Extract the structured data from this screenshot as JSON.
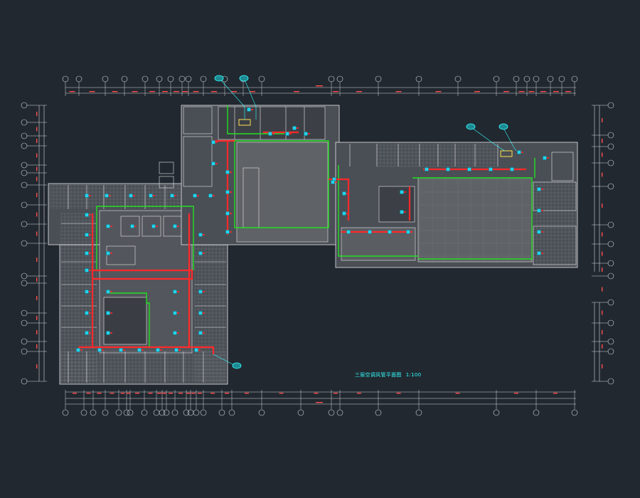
{
  "drawing": {
    "title": "三层空调风管平面图",
    "scale": "1:100"
  },
  "colors": {
    "background": "#212830",
    "dimension_line": "#d9d9d9",
    "dimension_text": "#ff4d4d",
    "wall": "#e6e6e6",
    "fill_dark": "#4a4e55",
    "fill_floor": "#5f6266",
    "supply_duct": "#ff2a2a",
    "return_duct": "#22e022",
    "diffuser": "#22d3ee",
    "title_text": "#33ffff"
  },
  "symbols": {
    "axis_bubble": "axis-grid-bubble",
    "diffuser": "air-diffuser-icon",
    "ahu": "air-handling-unit-icon",
    "leader_tag": "equipment-tag-icon"
  }
}
